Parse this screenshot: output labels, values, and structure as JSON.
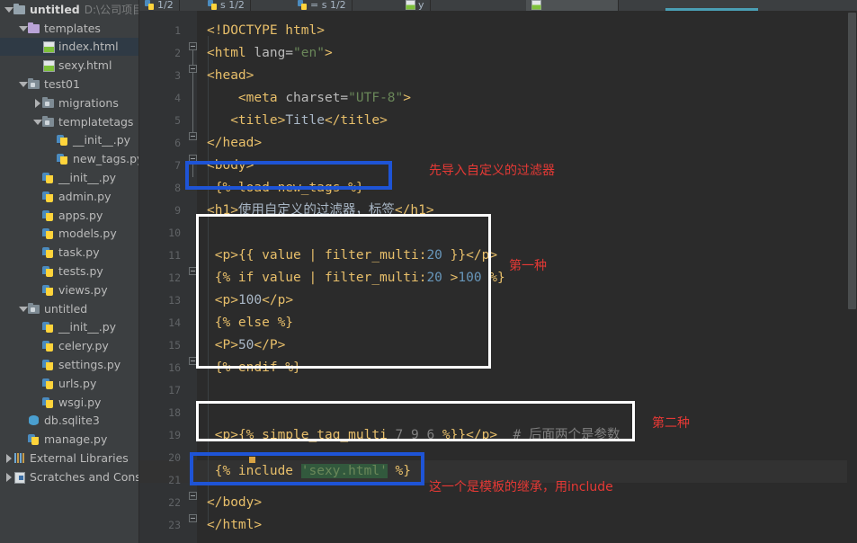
{
  "window": {
    "editor_bg": "#2b2b2b",
    "sidebar_bg": "#3c3f41",
    "accent_blue": "#1e54d6",
    "annotation_red": "#e53935",
    "selection_bg": "#2f3a45"
  },
  "tabs": [
    {
      "label": "1/2",
      "icon": "python-file-icon",
      "selected": false
    },
    {
      "label": "s 1/2",
      "icon": "python-file-icon",
      "selected": false
    },
    {
      "label": "= s 1/2",
      "icon": "python-file-icon",
      "selected": false
    },
    {
      "label": "y",
      "icon": "html-file-icon",
      "selected": false
    },
    {
      "label": "",
      "icon": "html-file-icon",
      "selected": true
    }
  ],
  "sidebar": {
    "items": [
      {
        "label": "untitled",
        "sub": "D:\\公司项目\\",
        "icon": "folder-icon",
        "indent": 0,
        "arrow": "down",
        "bold": true,
        "selected": false
      },
      {
        "label": "templates",
        "sub": "",
        "icon": "folder-purple-icon",
        "indent": 1,
        "arrow": "down",
        "bold": false,
        "selected": false
      },
      {
        "label": "index.html",
        "sub": "",
        "icon": "html-file-icon",
        "indent": 2,
        "arrow": "none",
        "bold": false,
        "selected": true
      },
      {
        "label": "sexy.html",
        "sub": "",
        "icon": "html-file-icon",
        "indent": 2,
        "arrow": "none",
        "bold": false,
        "selected": false
      },
      {
        "label": "test01",
        "sub": "",
        "icon": "module-folder-icon",
        "indent": 1,
        "arrow": "down",
        "bold": false,
        "selected": false
      },
      {
        "label": "migrations",
        "sub": "",
        "icon": "module-folder-icon",
        "indent": 2,
        "arrow": "right",
        "bold": false,
        "selected": false
      },
      {
        "label": "templatetags",
        "sub": "",
        "icon": "module-folder-icon",
        "indent": 2,
        "arrow": "down",
        "bold": false,
        "selected": false
      },
      {
        "label": "__init__.py",
        "sub": "",
        "icon": "python-file-icon",
        "indent": 3,
        "arrow": "none",
        "bold": false,
        "selected": false
      },
      {
        "label": "new_tags.py",
        "sub": "",
        "icon": "python-file-icon",
        "indent": 3,
        "arrow": "none",
        "bold": false,
        "selected": false
      },
      {
        "label": "__init__.py",
        "sub": "",
        "icon": "python-file-icon",
        "indent": 2,
        "arrow": "none",
        "bold": false,
        "selected": false
      },
      {
        "label": "admin.py",
        "sub": "",
        "icon": "python-file-icon",
        "indent": 2,
        "arrow": "none",
        "bold": false,
        "selected": false
      },
      {
        "label": "apps.py",
        "sub": "",
        "icon": "python-file-icon",
        "indent": 2,
        "arrow": "none",
        "bold": false,
        "selected": false
      },
      {
        "label": "models.py",
        "sub": "",
        "icon": "python-file-icon",
        "indent": 2,
        "arrow": "none",
        "bold": false,
        "selected": false
      },
      {
        "label": "task.py",
        "sub": "",
        "icon": "python-file-icon",
        "indent": 2,
        "arrow": "none",
        "bold": false,
        "selected": false
      },
      {
        "label": "tests.py",
        "sub": "",
        "icon": "python-file-icon",
        "indent": 2,
        "arrow": "none",
        "bold": false,
        "selected": false
      },
      {
        "label": "views.py",
        "sub": "",
        "icon": "python-file-icon",
        "indent": 2,
        "arrow": "none",
        "bold": false,
        "selected": false
      },
      {
        "label": "untitled",
        "sub": "",
        "icon": "module-folder-icon",
        "indent": 1,
        "arrow": "down",
        "bold": false,
        "selected": false
      },
      {
        "label": "__init__.py",
        "sub": "",
        "icon": "python-file-icon",
        "indent": 2,
        "arrow": "none",
        "bold": false,
        "selected": false
      },
      {
        "label": "celery.py",
        "sub": "",
        "icon": "python-file-icon",
        "indent": 2,
        "arrow": "none",
        "bold": false,
        "selected": false
      },
      {
        "label": "settings.py",
        "sub": "",
        "icon": "python-file-icon",
        "indent": 2,
        "arrow": "none",
        "bold": false,
        "selected": false
      },
      {
        "label": "urls.py",
        "sub": "",
        "icon": "python-file-icon",
        "indent": 2,
        "arrow": "none",
        "bold": false,
        "selected": false
      },
      {
        "label": "wsgi.py",
        "sub": "",
        "icon": "python-file-icon",
        "indent": 2,
        "arrow": "none",
        "bold": false,
        "selected": false
      },
      {
        "label": "db.sqlite3",
        "sub": "",
        "icon": "database-icon",
        "indent": 1,
        "arrow": "none",
        "bold": false,
        "selected": false
      },
      {
        "label": "manage.py",
        "sub": "",
        "icon": "python-file-icon",
        "indent": 1,
        "arrow": "none",
        "bold": false,
        "selected": false
      },
      {
        "label": "External Libraries",
        "sub": "",
        "icon": "libraries-icon",
        "indent": 0,
        "arrow": "right",
        "bold": false,
        "selected": false
      },
      {
        "label": "Scratches and Consoles",
        "sub": "",
        "icon": "scratches-icon",
        "indent": 0,
        "arrow": "right",
        "bold": false,
        "selected": false
      }
    ]
  },
  "editor": {
    "line_numbers": [
      "1",
      "2",
      "3",
      "4",
      "5",
      "6",
      "7",
      "8",
      "9",
      "10",
      "11",
      "12",
      "13",
      "14",
      "15",
      "16",
      "17",
      "18",
      "19",
      "20",
      "21",
      "22",
      "23"
    ],
    "lines": [
      {
        "n": "1",
        "text": "<!DOCTYPE html>"
      },
      {
        "n": "2",
        "text": "<html lang=\"en\">"
      },
      {
        "n": "3",
        "text": "<head>"
      },
      {
        "n": "4",
        "text": "    <meta charset=\"UTF-8\">"
      },
      {
        "n": "5",
        "text": "    <title>Title</title>"
      },
      {
        "n": "6",
        "text": "</head>"
      },
      {
        "n": "7",
        "text": "<body>"
      },
      {
        "n": "8",
        "text": "{% load new_tags %}"
      },
      {
        "n": "9",
        "text": "<h1>使用自定义的过滤器，标签</h1>"
      },
      {
        "n": "10",
        "text": ""
      },
      {
        "n": "11",
        "text": "<p>{{ value | filter_multi:20 }}</p>"
      },
      {
        "n": "12",
        "text": "{% if value | filter_multi:20 >100 %}"
      },
      {
        "n": "13",
        "text": "<p>100</p>"
      },
      {
        "n": "14",
        "text": "{% else %}"
      },
      {
        "n": "15",
        "text": "<P>50</P>"
      },
      {
        "n": "16",
        "text": "{% endif %}"
      },
      {
        "n": "17",
        "text": ""
      },
      {
        "n": "18",
        "text": ""
      },
      {
        "n": "19",
        "text": "<p>{% simple_tag_multi 7 9 6 %}}</p>  # 后面两个是参数"
      },
      {
        "n": "20",
        "text": ""
      },
      {
        "n": "21",
        "text": "{% include 'sexy.html' %}"
      },
      {
        "n": "22",
        "text": "</body>"
      },
      {
        "n": "23",
        "text": "</html>"
      }
    ],
    "tokens": {
      "l1_doctype": "<!DOCTYPE html>",
      "l2_a": "<html ",
      "l2_b": "lang=",
      "l2_c": "\"en\"",
      "l2_d": ">",
      "l3": "<head>",
      "l4_a": "<meta ",
      "l4_b": "charset=",
      "l4_c": "\"UTF-8\"",
      "l4_d": ">",
      "l5_a": "<title>",
      "l5_b": "Title",
      "l5_c": "</title>",
      "l6": "</head>",
      "l7": "<body>",
      "l8_a": "{%",
      "l8_b": " load new_tags ",
      "l8_c": "%}",
      "l9_a": "<h1>",
      "l9_b": "使用自定义的过滤器，标签",
      "l9_c": "</h1>",
      "l11_a": "<p>",
      "l11_b": "{{ value | filter_multi:",
      "l11_c": "20",
      "l11_d": " }}",
      "l11_e": "</p>",
      "l12_a": "{% if value | filter_multi:",
      "l12_b": "20",
      "l12_c": " >",
      "l12_d": "100",
      "l12_e": " %}",
      "l13_a": "<p>",
      "l13_b": "100",
      "l13_c": "</p>",
      "l14": "{% else %}",
      "l15_a": "<P>",
      "l15_b": "50",
      "l15_c": "</P>",
      "l16": "{% endif %}",
      "l19_a": "<p>",
      "l19_b": "{% simple_tag_multi ",
      "l19_c": "7 9 6",
      "l19_d": " %}}",
      "l19_e": "</p>",
      "l19_f": "  # 后面两个是参数",
      "l21_a": "{% include ",
      "l21_b": "'sexy.html'",
      "l21_c": " %}",
      "l22": "</body>",
      "l23": "</html>"
    }
  },
  "annotations": [
    {
      "id": "anno-1",
      "text": "先导入自定义的过滤器"
    },
    {
      "id": "anno-2",
      "text": "第一种"
    },
    {
      "id": "anno-3",
      "text": "第二种"
    },
    {
      "id": "anno-4",
      "text": "这一个是模板的继承，用include"
    }
  ]
}
